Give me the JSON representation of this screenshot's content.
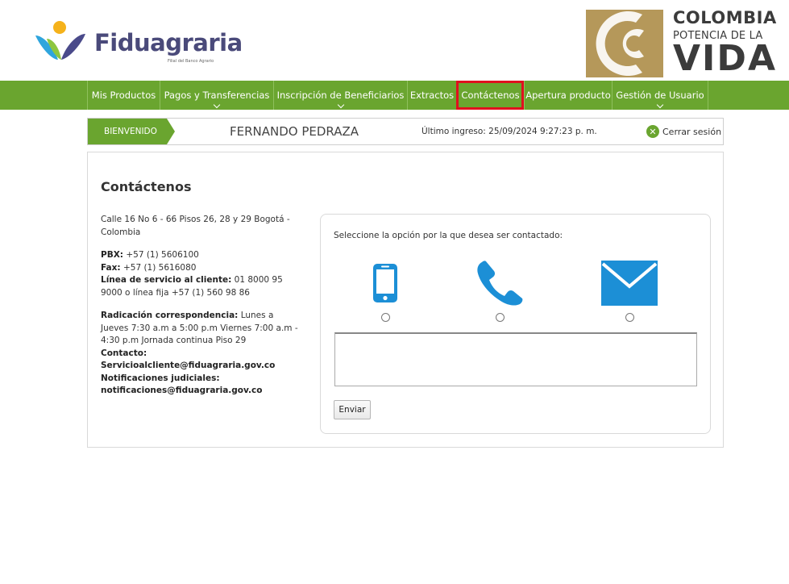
{
  "header": {
    "brand_name": "Fiduagraria",
    "brand_tagline": "Filial del Banco Agrario",
    "gov_logo": {
      "line1": "COLOMBIA",
      "line2": "POTENCIA DE LA",
      "line3": "VIDA"
    }
  },
  "nav": {
    "items": [
      {
        "label": "Mis Productos",
        "has_dropdown": false
      },
      {
        "label": "Pagos y Transferencias",
        "has_dropdown": true
      },
      {
        "label": "Inscripción de Beneficiarios",
        "has_dropdown": true
      },
      {
        "label": "Extractos",
        "has_dropdown": false
      },
      {
        "label": "Contáctenos",
        "has_dropdown": false,
        "active": true
      },
      {
        "label": "Apertura producto",
        "has_dropdown": false
      },
      {
        "label": "Gestión de Usuario",
        "has_dropdown": true
      }
    ]
  },
  "welcome": {
    "tag": "BIENVENIDO",
    "user_name": "FERNANDO PEDRAZA",
    "last_login": "Último ingreso: 25/09/2024 9:27:23 p. m.",
    "logout_label": "Cerrar sesión"
  },
  "contact": {
    "title": "Contáctenos",
    "address": "Calle 16 No 6 - 66 Pisos 26, 28 y 29 Bogotá - Colombia",
    "pbx_label": "PBX:",
    "pbx_value": " +57 (1) 5606100",
    "fax_label": "Fax:",
    "fax_value": " +57 (1) 5616080",
    "service_label": "Línea de servicio al cliente:",
    "service_value": " 01 8000 95 9000 o línea fija +57 (1) 560 98 86",
    "radicacion_label": "Radicación correspondencia:",
    "radicacion_value": " Lunes a Jueves 7:30 a.m a 5:00 p.m Viernes 7:00 a.m - 4:30 p.m Jornada continua Piso 29",
    "contacto_label": "Contacto:",
    "contacto_email": "Servicioalcliente@fiduagraria.gov.co",
    "judicial_label": "Notificaciones judiciales:",
    "judicial_email": "notificaciones@fiduagraria.gov.co"
  },
  "form": {
    "prompt": "Seleccione la opción por la que desea ser contactado:",
    "options": [
      {
        "icon": "mobile-phone-icon"
      },
      {
        "icon": "telephone-icon"
      },
      {
        "icon": "email-envelope-icon"
      }
    ],
    "message_value": "",
    "send_label": "Enviar"
  },
  "colors": {
    "nav_green": "#6aa52f",
    "icon_blue": "#1c8fd6",
    "active_outline": "#e0101e",
    "gov_gold": "#b5985a"
  }
}
